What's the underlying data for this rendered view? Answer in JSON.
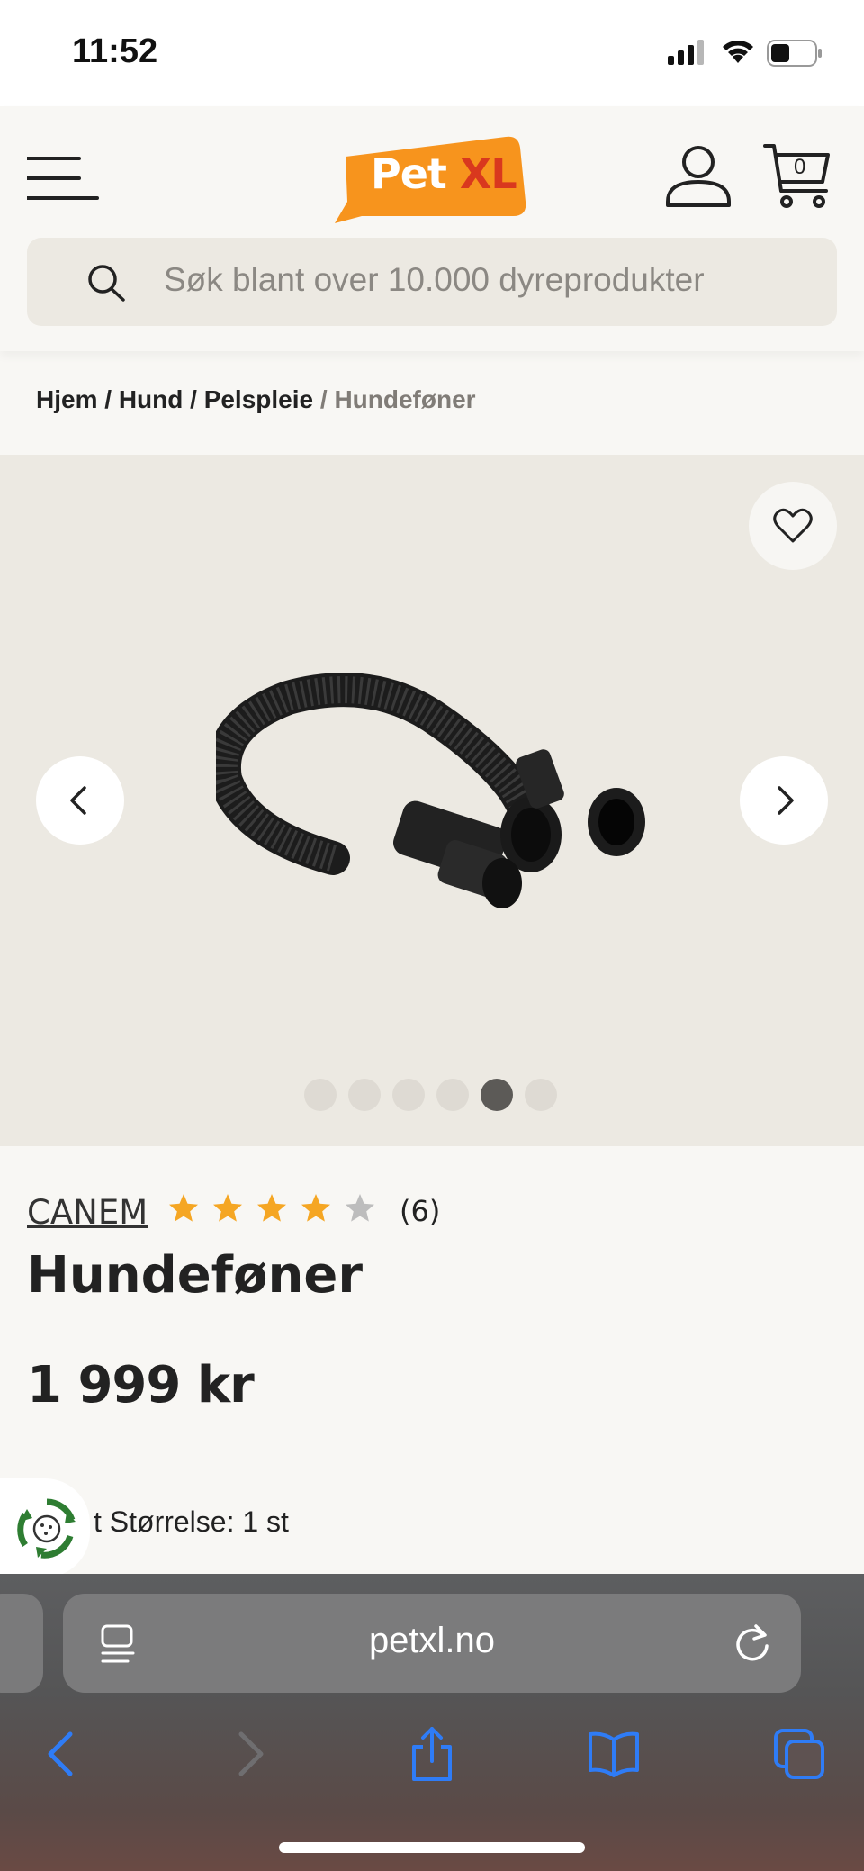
{
  "status_bar": {
    "time": "11:52"
  },
  "header": {
    "logo": {
      "part1": "Pet",
      "part2": "XL"
    },
    "cart_count": "0",
    "search_placeholder": "Søk blant over 10.000 dyreprodukter"
  },
  "breadcrumb": {
    "items": [
      "Hjem",
      "Hund",
      "Pelspleie"
    ],
    "separator": "/",
    "current": "Hundeføner"
  },
  "gallery": {
    "slide_count": 6,
    "active_slide": 5
  },
  "product": {
    "brand": "CANEM",
    "rating": 4,
    "rating_max": 5,
    "review_count": "(6)",
    "title": "Hundeføner",
    "price": "1 999 kr",
    "variant_text": "t Størrelse: 1 st"
  },
  "browser": {
    "url": "petxl.no"
  },
  "colors": {
    "logo_orange": "#f7941d",
    "logo_red": "#d9381e",
    "star_filled": "#f5a623",
    "star_empty": "#bdbdbd",
    "ios_blue": "#2f7cf6"
  }
}
